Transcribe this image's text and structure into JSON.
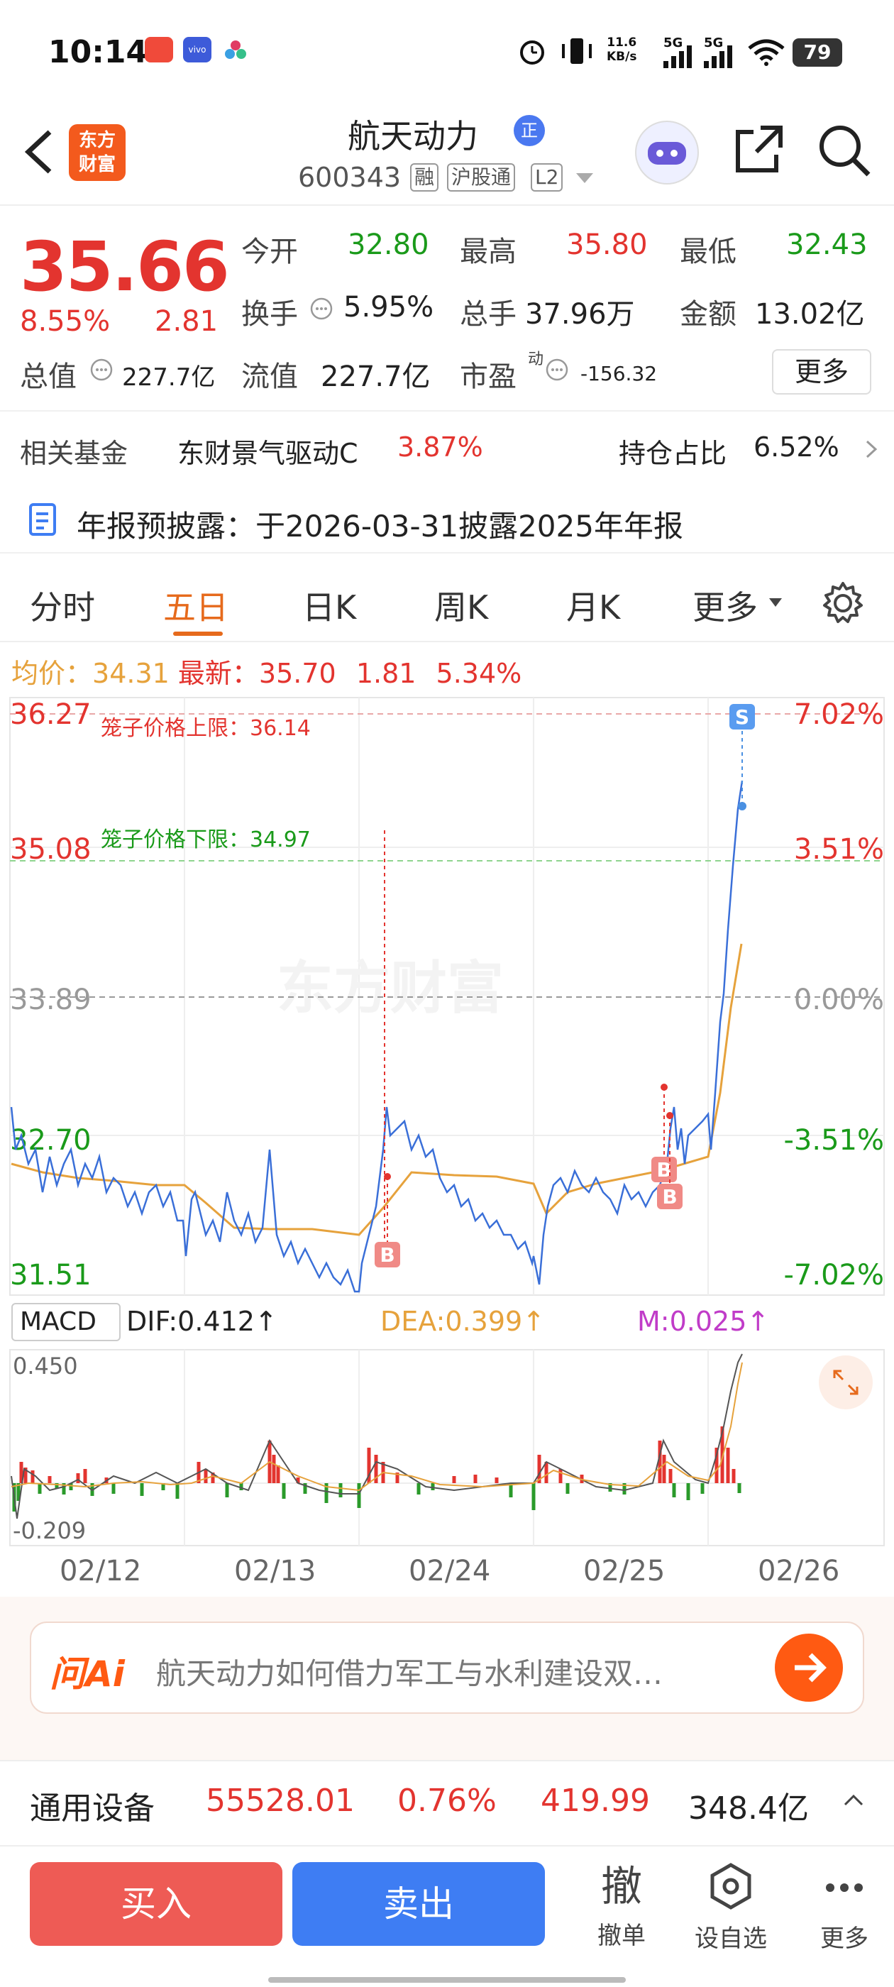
{
  "status_bar": {
    "time": "10:14",
    "netspeed_top": "11.6",
    "netspeed_bottom": "KB/s",
    "net1": "5G",
    "net2": "5G",
    "battery": "79",
    "vivo_label": "vivo"
  },
  "header": {
    "stock_name": "航天动力",
    "zheng_badge": "正",
    "stock_code": "600343",
    "tags": [
      "融",
      "沪股通",
      "L2"
    ],
    "logo_line1": "东方",
    "logo_line2": "财富"
  },
  "quote": {
    "price": "35.66",
    "change_pct": "8.55%",
    "change": "2.81",
    "open_label": "今开",
    "open": "32.80",
    "high_label": "最高",
    "high": "35.80",
    "low_label": "最低",
    "low": "32.43",
    "turnover_label": "换手",
    "turnover": "5.95%",
    "volume_label": "总手",
    "volume": "37.96万",
    "amount_label": "金额",
    "amount": "13.02亿",
    "mktcap_label": "总值",
    "mktcap": "227.7亿",
    "float_label": "流值",
    "float": "227.7亿",
    "pe_label": "市盈",
    "pe_sup": "动",
    "pe": "-156.32",
    "more": "更多"
  },
  "fund": {
    "label": "相关基金",
    "name": "东财景气驱动C",
    "pct": "3.87%",
    "hold_label": "持仓占比",
    "hold": "6.52%"
  },
  "report": {
    "text": "年报预披露：于2026-03-31披露2025年年报"
  },
  "tabs": [
    "分时",
    "五日",
    "日K",
    "周K",
    "月K",
    "更多"
  ],
  "chart_info": {
    "avg_label": "均价：",
    "avg": "34.31",
    "latest_label": "最新：",
    "latest": "35.70",
    "chg": "1.81",
    "chg_pct": "5.34%"
  },
  "chart": {
    "y_left": [
      "36.27",
      "35.08",
      "33.89",
      "32.70",
      "31.51"
    ],
    "y_right": [
      "7.02%",
      "3.51%",
      "0.00%",
      "-3.51%",
      "-7.02%"
    ],
    "upper_limit": "笼子价格上限：36.14",
    "lower_limit": "笼子价格下限：34.97",
    "watermark": "东方财富",
    "marker_s": "S",
    "marker_b": "B"
  },
  "macd": {
    "label": "MACD",
    "dif": "DIF:0.412",
    "dea": "DEA:0.399",
    "m": "M:0.025",
    "arrow": "↑",
    "top": "0.450",
    "bottom": "-0.209"
  },
  "dates": [
    "02/12",
    "02/13",
    "02/24",
    "02/25",
    "02/26"
  ],
  "ai": {
    "brand": "问Ai",
    "prompt": "航天动力如何借力军工与水利建设双…"
  },
  "sector": {
    "name": "通用设备",
    "index": "55528.01",
    "pct": "0.76%",
    "chg": "419.99",
    "amount": "348.4亿"
  },
  "bottom": {
    "buy": "买入",
    "sell": "卖出",
    "cancel_glyph": "撤",
    "cancel": "撤单",
    "watch": "设自选",
    "more": "更多"
  },
  "colors": {
    "up": "#e3342f",
    "down": "#1a9a1a",
    "avg_line": "#e6a23c",
    "accent": "#e66a1c",
    "sell": "#3e7df3"
  }
}
